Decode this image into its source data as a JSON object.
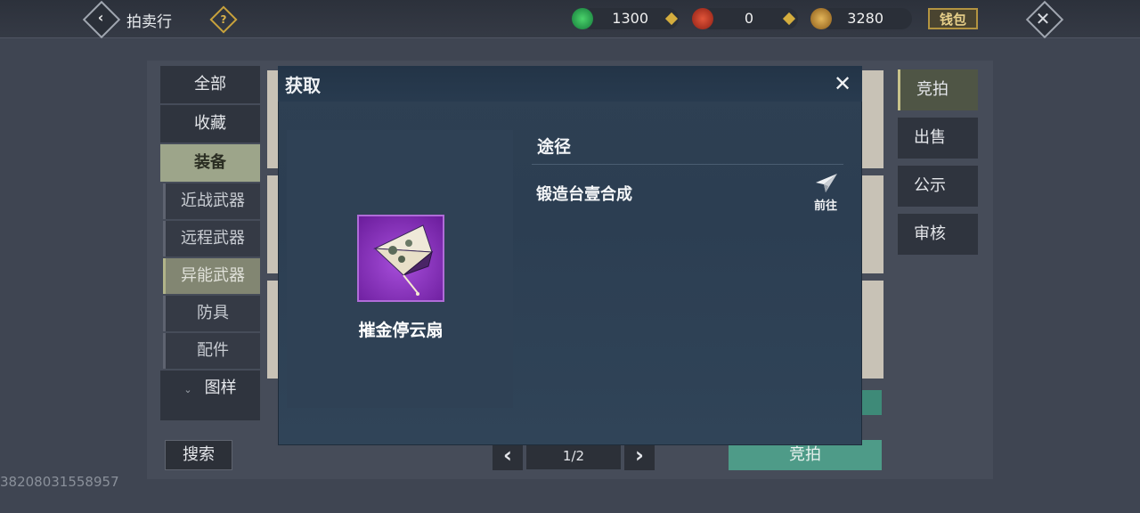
{
  "header": {
    "title": "拍卖行",
    "back_icon": "chevron-left-icon",
    "help_icon": "question-icon",
    "currencies": [
      {
        "name": "jade-coin-icon",
        "value": "1300"
      },
      {
        "name": "red-token-icon",
        "value": "0"
      },
      {
        "name": "gold-leaf-icon",
        "value": "3280"
      }
    ],
    "wallet_label": "钱包",
    "close_icon": "close-icon"
  },
  "sidebar": {
    "categories": [
      "全部",
      "收藏",
      "装备"
    ],
    "subcategories": [
      "近战武器",
      "远程武器",
      "异能武器",
      "防具",
      "配件"
    ],
    "collapsed_label": "图样",
    "active_category": "装备",
    "active_subcategory": "异能武器"
  },
  "right_tabs": [
    "竞拍",
    "出售",
    "公示",
    "审核"
  ],
  "bottom": {
    "search_label": "搜索",
    "page": "1/2",
    "bid_label": "竞拍",
    "user_id": "38208031558957"
  },
  "modal": {
    "title": "获取",
    "item_name": "摧金停云扇",
    "route_header": "途径",
    "routes": [
      {
        "label": "锻造台壹合成",
        "action": "前往"
      }
    ]
  },
  "colors": {
    "background": "#3f4552",
    "modal": "#2e4053",
    "accent_green": "#4e9b88",
    "item_purple": "#a84fdc",
    "gold": "#d4ad3e"
  }
}
